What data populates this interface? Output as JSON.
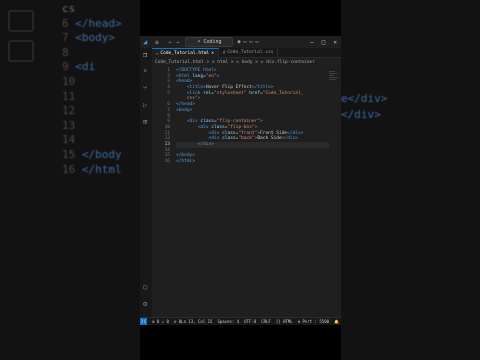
{
  "background": {
    "left_lines": [
      {
        "num": "",
        "text": "cs"
      },
      {
        "num": "6",
        "text": "</head>"
      },
      {
        "num": "7",
        "text": "<body>"
      },
      {
        "num": "8",
        "text": ""
      },
      {
        "num": "9",
        "text": "<di"
      },
      {
        "num": "10",
        "text": ""
      },
      {
        "num": "11",
        "text": ""
      },
      {
        "num": "12",
        "text": ""
      },
      {
        "num": "13",
        "text": ""
      },
      {
        "num": "14",
        "text": ""
      },
      {
        "num": "15",
        "text": "</body"
      },
      {
        "num": "16",
        "text": "</html"
      }
    ],
    "right_lines": [
      "e</div>",
      "</div>"
    ]
  },
  "titlebar": {
    "search_label": "Coding",
    "logo_icon": "vscode-icon"
  },
  "tabs": [
    {
      "label": "Code_Tutorial.html",
      "active": true
    },
    {
      "label": "Code_Tutorial.css",
      "active": false
    }
  ],
  "breadcrumb": "Code_Tutorial.html > ◇ html > ◇ body > ◇ div.flip-container",
  "editor": {
    "current_line": 13,
    "lines": [
      {
        "n": "1",
        "html": "<span class='t'>&lt;!DOCTYPE html&gt;</span>"
      },
      {
        "n": "2",
        "html": "<span class='t'>&lt;html</span> <span class='a'>lang</span>=<span class='s'>\"en\"</span><span class='t'>&gt;</span>"
      },
      {
        "n": "3",
        "html": "<span class='t'>&lt;head&gt;</span>"
      },
      {
        "n": "4",
        "html": "    <span class='t'>&lt;title&gt;</span>Hover Flip Effect<span class='t'>&lt;/title&gt;</span>"
      },
      {
        "n": "5",
        "html": "    <span class='t'>&lt;link</span> <span class='a'>rel</span>=<span class='s'>\"stylesheet\"</span> <span class='a'>href</span>=<span class='s'>\"Code_Tutorial_</span>"
      },
      {
        "n": "",
        "html": "    <span class='s'>css\"</span><span class='t'>&gt;</span>"
      },
      {
        "n": "6",
        "html": "<span class='t'>&lt;/head&gt;</span>"
      },
      {
        "n": "7",
        "html": "<span class='t'>&lt;body&gt;</span>"
      },
      {
        "n": "8",
        "html": ""
      },
      {
        "n": "9",
        "html": "    <span class='t'>&lt;div</span> <span class='a'>class</span>=<span class='s'>\"flip-container\"</span><span class='t'>&gt;</span>"
      },
      {
        "n": "10",
        "html": "        <span class='t'>&lt;div</span> <span class='a'>class</span>=<span class='s'>\"flip-box\"</span><span class='t'>&gt;</span>"
      },
      {
        "n": "11",
        "html": "            <span class='t'>&lt;div</span> <span class='a'>class</span>=<span class='s'>\"front\"</span><span class='t'>&gt;</span>Front Side<span class='t'>&lt;/div&gt;</span>"
      },
      {
        "n": "12",
        "html": "            <span class='t'>&lt;div</span> <span class='a'>class</span>=<span class='s'>\"back\"</span><span class='t'>&gt;</span>Back Side<span class='t'>&lt;/div&gt;</span>"
      },
      {
        "n": "13",
        "html": "        <span class='t'>&lt;/div&gt;</span>"
      },
      {
        "n": "14",
        "html": ""
      },
      {
        "n": "15",
        "html": "<span class='t'>&lt;/body&gt;</span>"
      },
      {
        "n": "16",
        "html": "<span class='t'>&lt;/html&gt;</span>"
      }
    ]
  },
  "statusbar": {
    "problems": "⊗ 0 ⚠ 0",
    "port": "⊙ 0",
    "position": "Ln 13, Col 15",
    "spaces": "Spaces: 4",
    "encoding": "UTF-8",
    "eol": "CRLF",
    "language": "{} HTML",
    "port_label": "⊕ Port : 5500"
  },
  "colors": {
    "accent": "#0078d4",
    "tag": "#569cd6",
    "attr": "#9cdcfe",
    "string": "#ce9178"
  }
}
